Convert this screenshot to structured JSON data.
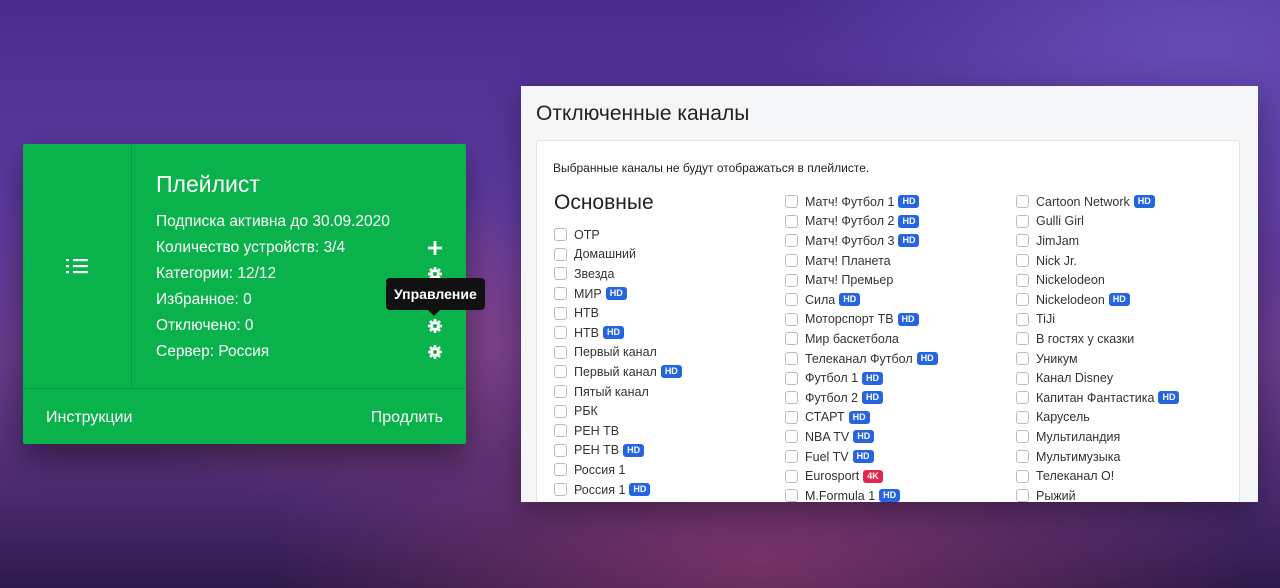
{
  "colors": {
    "card_green": "#0ab24b",
    "badge_hd": "#2565e0",
    "badge_4k": "#e3264f",
    "tooltip_bg": "#111111"
  },
  "card": {
    "icon": "playlist-icon",
    "title": "Плейлист",
    "lines": [
      {
        "text": "Подписка активна до 30.09.2020",
        "icon": ""
      },
      {
        "text": "Количество устройств: 3/4",
        "icon": "plus-icon"
      },
      {
        "text": "Категории: 12/12",
        "icon": "gear-icon"
      },
      {
        "text": "Избранное: 0",
        "icon": ""
      },
      {
        "text": "Отключено: 0",
        "icon": "gear-icon"
      },
      {
        "text": "Сервер: Россия",
        "icon": "gear-icon"
      }
    ],
    "footer": {
      "instructions": "Инструкции",
      "extend": "Продлить"
    }
  },
  "tooltip": {
    "text": "Управление"
  },
  "panel": {
    "title": "Отключенные каналы",
    "note": "Выбранные каналы не будут отображаться в плейлисте.",
    "group_title": "Основные",
    "columns": [
      [
        {
          "name": "ОТР",
          "badge": ""
        },
        {
          "name": "Домашний",
          "badge": ""
        },
        {
          "name": "Звезда",
          "badge": ""
        },
        {
          "name": "МИР",
          "badge": "HD"
        },
        {
          "name": "НТВ",
          "badge": ""
        },
        {
          "name": "НТВ",
          "badge": "HD"
        },
        {
          "name": "Первый канал",
          "badge": ""
        },
        {
          "name": "Первый канал",
          "badge": "HD"
        },
        {
          "name": "Пятый канал",
          "badge": ""
        },
        {
          "name": "РБК",
          "badge": ""
        },
        {
          "name": "РЕН ТВ",
          "badge": ""
        },
        {
          "name": "РЕН ТВ",
          "badge": "HD"
        },
        {
          "name": "Россия 1",
          "badge": ""
        },
        {
          "name": "Россия 1",
          "badge": "HD"
        }
      ],
      [
        {
          "name": "Матч! Футбол 1",
          "badge": "HD"
        },
        {
          "name": "Матч! Футбол 2",
          "badge": "HD"
        },
        {
          "name": "Матч! Футбол 3",
          "badge": "HD"
        },
        {
          "name": "Матч! Планета",
          "badge": ""
        },
        {
          "name": "Матч! Премьер",
          "badge": ""
        },
        {
          "name": "Сила",
          "badge": "HD"
        },
        {
          "name": "Моторспорт ТВ",
          "badge": "HD"
        },
        {
          "name": "Мир баскетбола",
          "badge": ""
        },
        {
          "name": "Телеканал Футбол",
          "badge": "HD"
        },
        {
          "name": "Футбол 1",
          "badge": "HD"
        },
        {
          "name": "Футбол 2",
          "badge": "HD"
        },
        {
          "name": "СТАРТ",
          "badge": "HD"
        },
        {
          "name": "NBA TV",
          "badge": "HD"
        },
        {
          "name": "Fuel TV",
          "badge": "HD"
        },
        {
          "name": "Eurosport",
          "badge": "4K"
        },
        {
          "name": "M.Formula 1",
          "badge": "HD"
        }
      ],
      [
        {
          "name": "Cartoon Network",
          "badge": "HD"
        },
        {
          "name": "Gulli Girl",
          "badge": ""
        },
        {
          "name": "JimJam",
          "badge": ""
        },
        {
          "name": "Nick Jr.",
          "badge": ""
        },
        {
          "name": "Nickelodeon",
          "badge": ""
        },
        {
          "name": "Nickelodeon",
          "badge": "HD"
        },
        {
          "name": "TiJi",
          "badge": ""
        },
        {
          "name": "В гостях у сказки",
          "badge": ""
        },
        {
          "name": "Уникум",
          "badge": ""
        },
        {
          "name": "Канал Disney",
          "badge": ""
        },
        {
          "name": "Капитан Фантастика",
          "badge": "HD"
        },
        {
          "name": "Карусель",
          "badge": ""
        },
        {
          "name": "Мультиландия",
          "badge": ""
        },
        {
          "name": "Мультимузыка",
          "badge": ""
        },
        {
          "name": "Телеканал О!",
          "badge": ""
        },
        {
          "name": "Рыжий",
          "badge": ""
        }
      ]
    ]
  }
}
